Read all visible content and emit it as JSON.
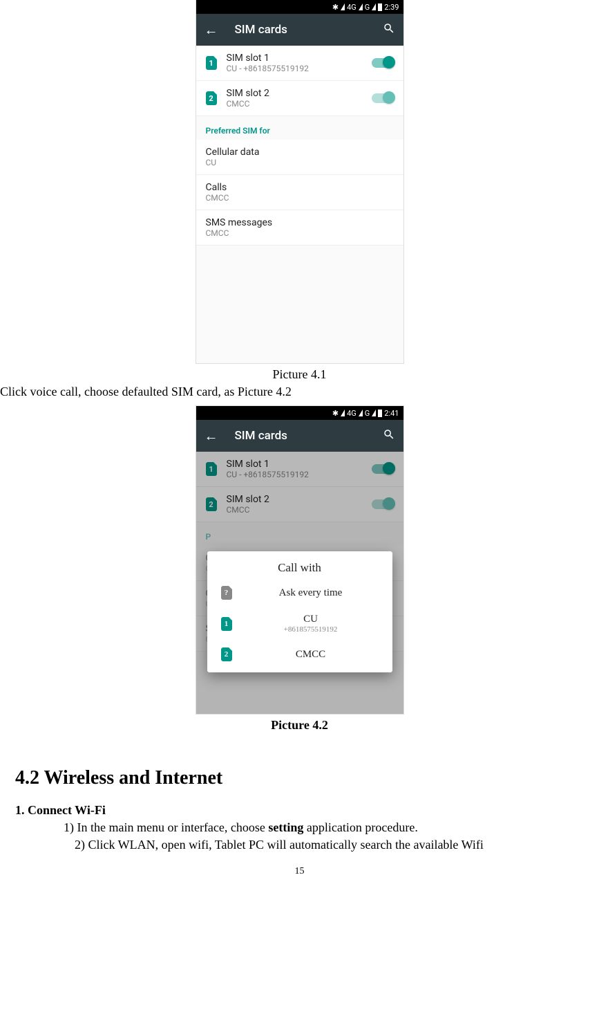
{
  "phone1": {
    "status_time": "2:39",
    "status_4g": "4G",
    "status_g": "G",
    "appbar_title": "SIM cards",
    "sim1_title": "SIM slot 1",
    "sim1_sub": "CU - +8618575519192",
    "sim1_badge": "1",
    "sim2_title": "SIM slot 2",
    "sim2_sub": "CMCC",
    "sim2_badge": "2",
    "pref_header": "Preferred SIM for",
    "cell_title": "Cellular data",
    "cell_sub": "CU",
    "calls_title": "Calls",
    "calls_sub": "CMCC",
    "sms_title": "SMS messages",
    "sms_sub": "CMCC"
  },
  "caption1": "Picture 4.1",
  "midtext": "Click voice call, choose defaulted SIM card, as Picture 4.2",
  "phone2": {
    "status_time": "2:41",
    "status_4g": "4G",
    "status_g": "G",
    "appbar_title": "SIM cards",
    "sim1_title": "SIM slot 1",
    "sim1_sub": "CU - +8618575519192",
    "sim1_badge": "1",
    "sim2_title": "SIM slot 2",
    "sim2_sub": "CMCC",
    "sim2_badge": "2",
    "pref_header_short": "P",
    "cell_title_short": "C",
    "cell_sub": "CU",
    "calls_title_short": "C",
    "calls_sub": "CMCC",
    "sms_title_short": "S",
    "sms_sub": "CMCC",
    "dialog_title": "Call with",
    "opt_ask": "Ask every time",
    "opt_ask_badge": "?",
    "opt_cu": "CU",
    "opt_cu_sub": "+8618575519192",
    "opt_cu_badge": "1",
    "opt_cmcc": "CMCC",
    "opt_cmcc_badge": "2"
  },
  "caption2": "Picture 4.2",
  "section_title": "4.2 Wireless and Internet",
  "sub1": "1. Connect Wi-Fi",
  "step1a": "1) In the main menu or interface, choose ",
  "step1b_bold": "setting",
  "step1c": " application procedure.",
  "step2": "2) Click WLAN, open wifi, Tablet PC will automatically search the available Wifi",
  "pagenum": "15"
}
